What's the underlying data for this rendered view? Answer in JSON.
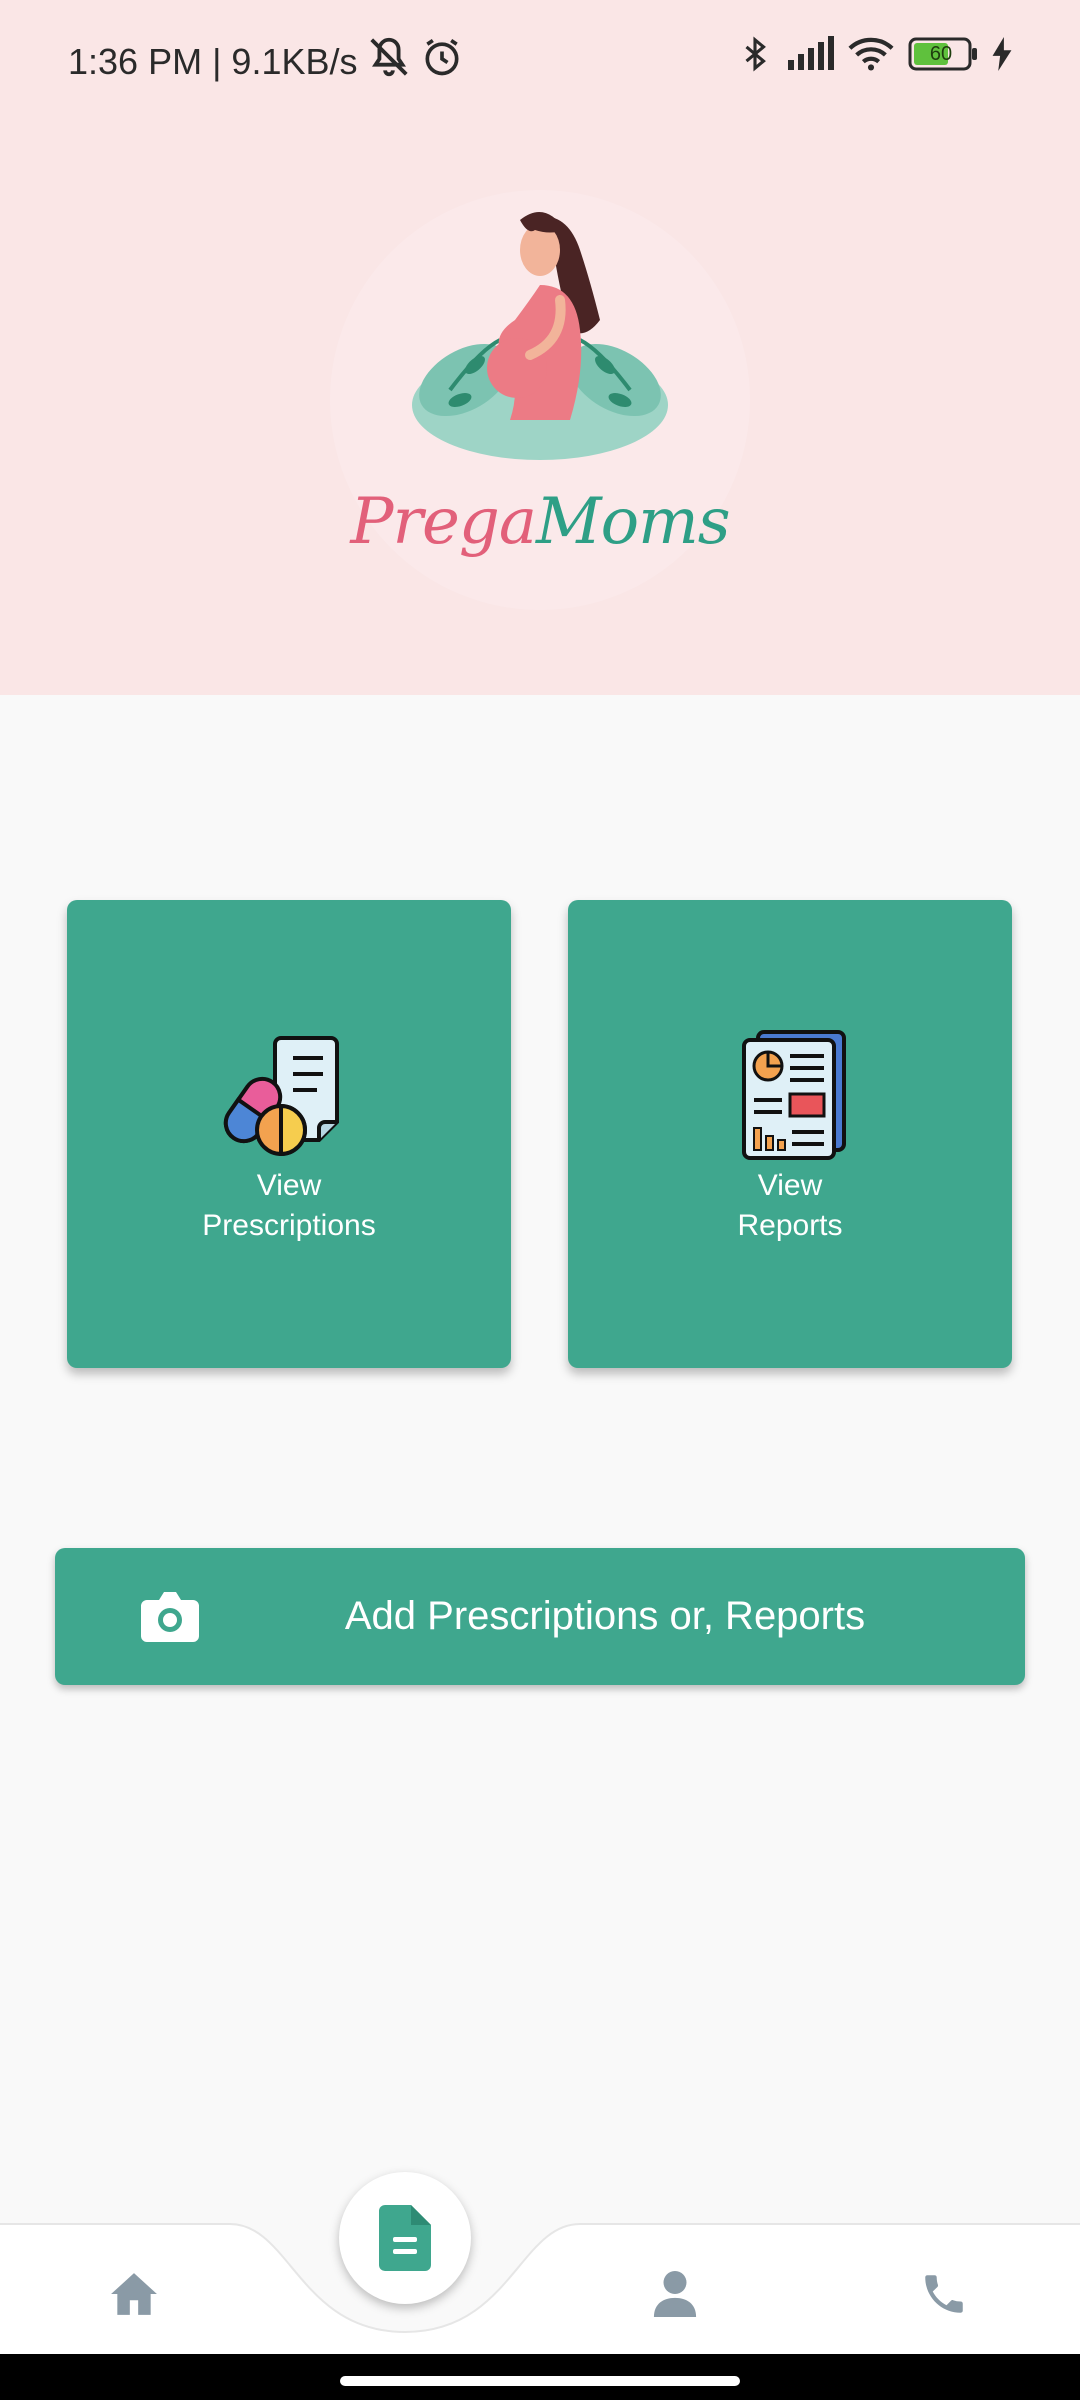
{
  "status_bar": {
    "time_and_speed": "1:36 PM | 9.1KB/s",
    "battery_level": "60"
  },
  "logo": {
    "brand_prega": "Prega",
    "brand_moms": "Moms"
  },
  "cards": {
    "prescriptions": {
      "line1": "View",
      "line2": "Prescriptions"
    },
    "reports": {
      "line1": "View",
      "line2": "Reports"
    }
  },
  "add_button": {
    "label": "Add Prescriptions or, Reports"
  },
  "colors": {
    "header_bg": "#fae6e6",
    "accent": "#3fa78e",
    "nav_icon": "#8a9aa6"
  },
  "bottom_nav": {
    "items": [
      "home-icon",
      "document-icon",
      "person-icon",
      "phone-icon"
    ],
    "active": "document-icon"
  }
}
